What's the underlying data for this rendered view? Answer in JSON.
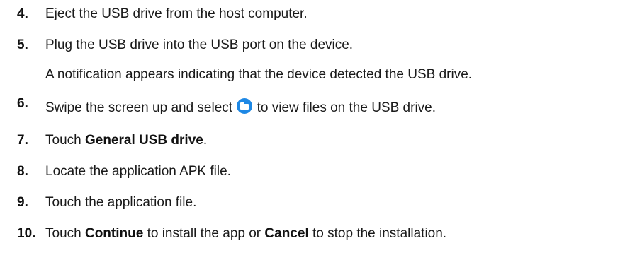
{
  "steps": [
    {
      "number": "4.",
      "text": "Eject the USB drive from the host computer."
    },
    {
      "number": "5.",
      "text": "Plug the USB drive into the USB port on the device.",
      "note": "A notification appears indicating that the device detected the USB drive."
    },
    {
      "number": "6.",
      "text_before": "Swipe the screen up and select ",
      "icon": "folder-app-icon",
      "text_after": " to view files on the USB drive."
    },
    {
      "number": "7.",
      "text_before": "Touch ",
      "bold": "General USB drive",
      "text_after": "."
    },
    {
      "number": "8.",
      "text": "Locate the application APK file."
    },
    {
      "number": "9.",
      "text": "Touch the application file."
    },
    {
      "number": "10.",
      "text_before": "Touch ",
      "bold1": "Continue",
      "text_middle": " to install the app or ",
      "bold2": "Cancel",
      "text_after": " to stop the installation."
    }
  ],
  "colors": {
    "text": "#1a1a1a",
    "icon": "#1e88e5"
  }
}
